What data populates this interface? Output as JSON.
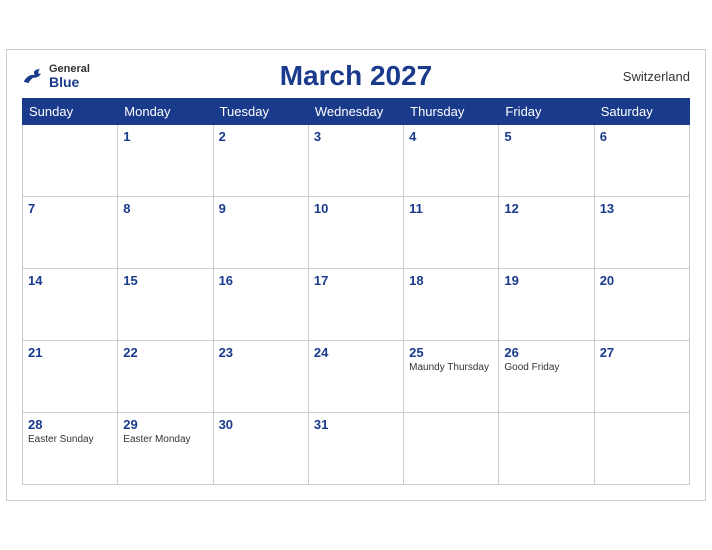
{
  "header": {
    "logo_general": "General",
    "logo_blue": "Blue",
    "title": "March 2027",
    "country": "Switzerland"
  },
  "weekdays": [
    "Sunday",
    "Monday",
    "Tuesday",
    "Wednesday",
    "Thursday",
    "Friday",
    "Saturday"
  ],
  "weeks": [
    [
      {
        "date": "",
        "holiday": ""
      },
      {
        "date": "1",
        "holiday": ""
      },
      {
        "date": "2",
        "holiday": ""
      },
      {
        "date": "3",
        "holiday": ""
      },
      {
        "date": "4",
        "holiday": ""
      },
      {
        "date": "5",
        "holiday": ""
      },
      {
        "date": "6",
        "holiday": ""
      }
    ],
    [
      {
        "date": "7",
        "holiday": ""
      },
      {
        "date": "8",
        "holiday": ""
      },
      {
        "date": "9",
        "holiday": ""
      },
      {
        "date": "10",
        "holiday": ""
      },
      {
        "date": "11",
        "holiday": ""
      },
      {
        "date": "12",
        "holiday": ""
      },
      {
        "date": "13",
        "holiday": ""
      }
    ],
    [
      {
        "date": "14",
        "holiday": ""
      },
      {
        "date": "15",
        "holiday": ""
      },
      {
        "date": "16",
        "holiday": ""
      },
      {
        "date": "17",
        "holiday": ""
      },
      {
        "date": "18",
        "holiday": ""
      },
      {
        "date": "19",
        "holiday": ""
      },
      {
        "date": "20",
        "holiday": ""
      }
    ],
    [
      {
        "date": "21",
        "holiday": ""
      },
      {
        "date": "22",
        "holiday": ""
      },
      {
        "date": "23",
        "holiday": ""
      },
      {
        "date": "24",
        "holiday": ""
      },
      {
        "date": "25",
        "holiday": "Maundy Thursday"
      },
      {
        "date": "26",
        "holiday": "Good Friday"
      },
      {
        "date": "27",
        "holiday": ""
      }
    ],
    [
      {
        "date": "28",
        "holiday": "Easter Sunday"
      },
      {
        "date": "29",
        "holiday": "Easter Monday"
      },
      {
        "date": "30",
        "holiday": ""
      },
      {
        "date": "31",
        "holiday": ""
      },
      {
        "date": "",
        "holiday": ""
      },
      {
        "date": "",
        "holiday": ""
      },
      {
        "date": "",
        "holiday": ""
      }
    ]
  ]
}
